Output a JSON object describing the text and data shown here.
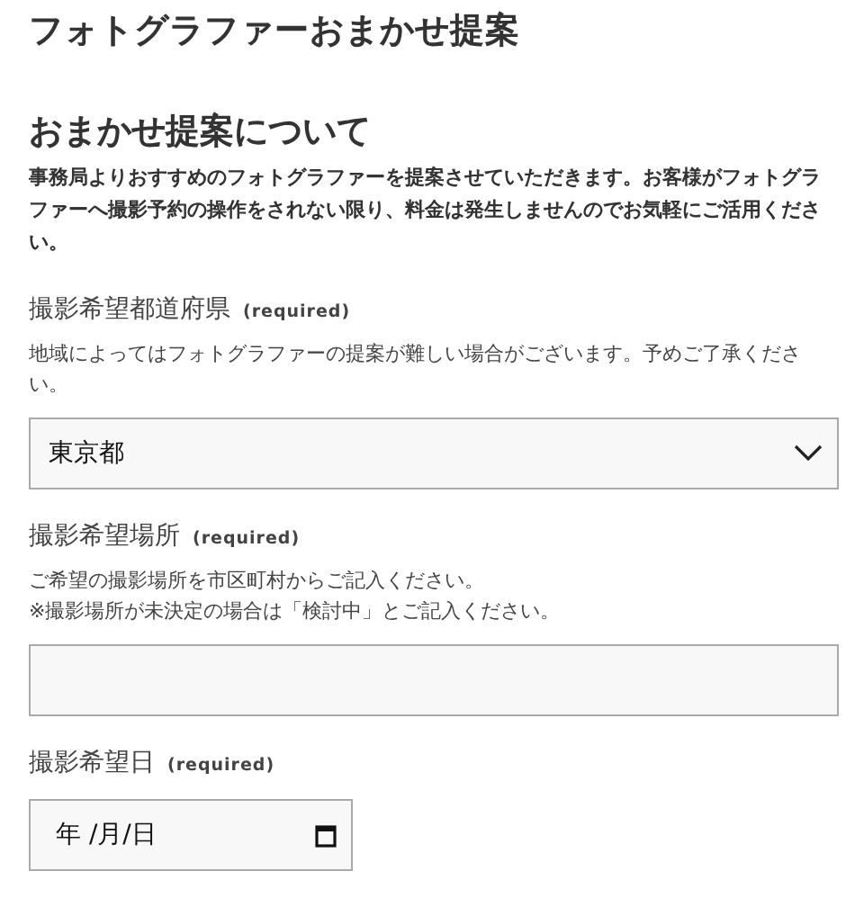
{
  "page_title": "フォトグラファーおまかせ提案",
  "section": {
    "heading": "おまかせ提案について",
    "description": "事務局よりおすすめのフォトグラファーを提案させていただきます。お客様がフォトグラファーへ撮影予約の操作をされない限り、料金は発生しませんのでお気軽にご活用ください。"
  },
  "fields": [
    {
      "kind": "select",
      "label": "撮影希望都道府県",
      "required_note": "(required)",
      "help": [
        "地域によってはフォトグラファーの提案が難しい場合がございます。予めご了承ください。"
      ],
      "value": "東京都"
    },
    {
      "kind": "text",
      "label": "撮影希望場所",
      "required_note": "(required)",
      "help": [
        "ご希望の撮影場所を市区町村からご記入ください。",
        "※撮影場所が未決定の場合は「検討中」とご記入ください。"
      ]
    },
    {
      "kind": "date",
      "label": "撮影希望日",
      "required_note": "(required)",
      "placeholder": "年 /月/日"
    }
  ]
}
